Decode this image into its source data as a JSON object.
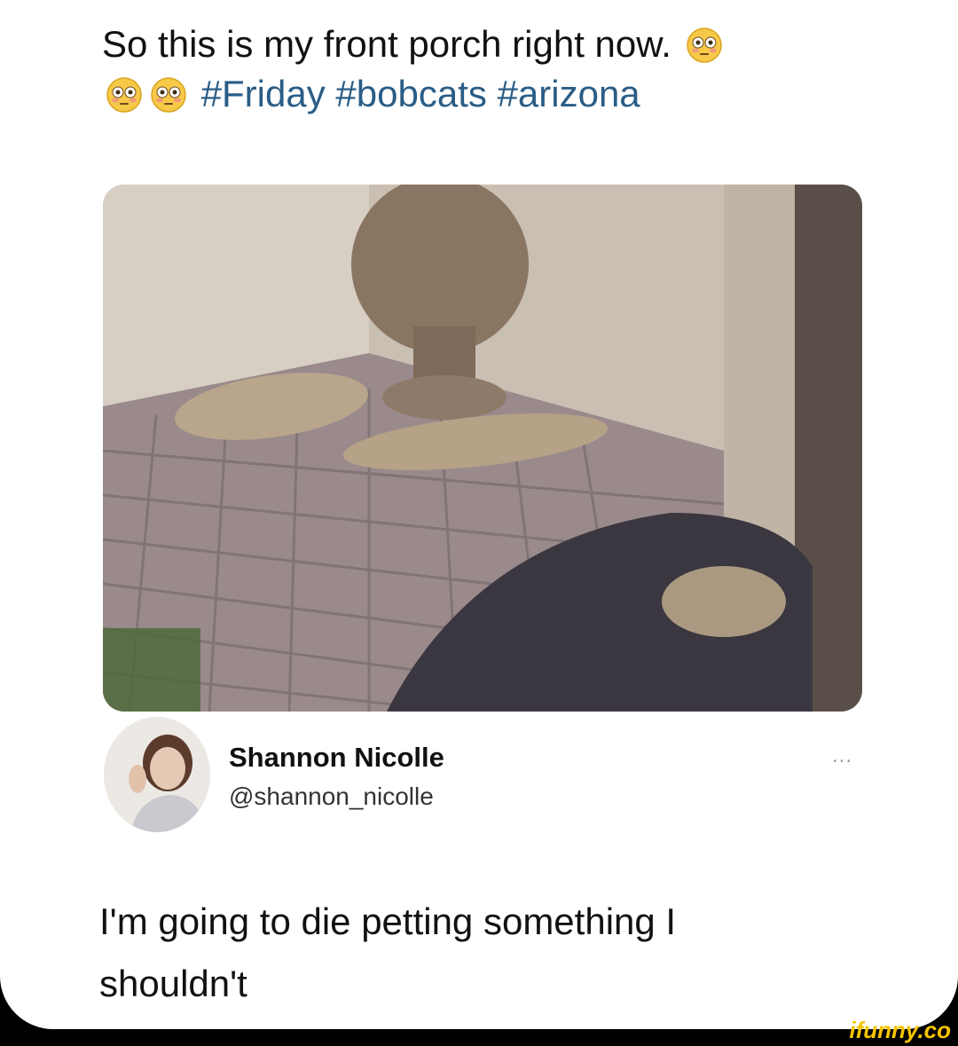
{
  "tweet": {
    "line1": "So this is my front porch right now.",
    "hashtags": [
      "#Friday",
      "#bobcats",
      "#arizona"
    ]
  },
  "emoji": {
    "name": "flushed-face-icon",
    "color": "#f7c948"
  },
  "author": {
    "name": "Shannon Nicolle",
    "handle": "@shannon_nicolle",
    "more": "..."
  },
  "reply": {
    "line1": "I'm going to die petting something I",
    "line2": "shouldn't"
  },
  "watermark": "ifunny.co"
}
